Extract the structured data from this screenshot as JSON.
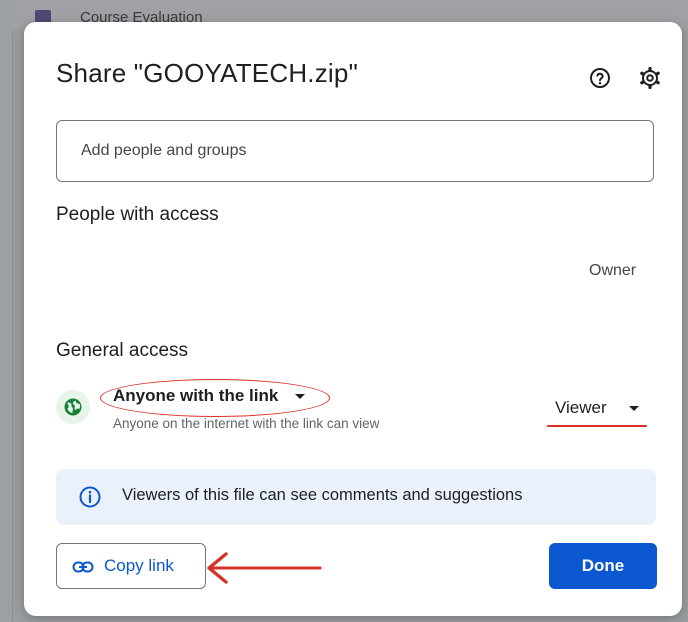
{
  "background": {
    "file_name": "Course Evaluation"
  },
  "dialog": {
    "title": "Share \"GOOYATECH.zip\"",
    "help_icon": "help-circle-icon",
    "settings_icon": "gear-icon"
  },
  "add_people": {
    "placeholder": "Add people and groups"
  },
  "people_with_access": {
    "title": "People with access",
    "owner_role": "Owner"
  },
  "general_access": {
    "title": "General access",
    "access_icon": "globe-icon",
    "access_level": "Anyone with the link",
    "access_description": "Anyone on the internet with the link can view",
    "role": "Viewer",
    "annotation_color": "#d93025"
  },
  "info_banner": {
    "icon": "info-icon",
    "text": "Viewers of this file can see comments and suggestions"
  },
  "footer": {
    "copy_link_label": "Copy link",
    "copy_link_icon": "link-icon",
    "done_label": "Done",
    "done_color": "#0b57d0",
    "arrow_icon": "red-arrow-icon"
  }
}
